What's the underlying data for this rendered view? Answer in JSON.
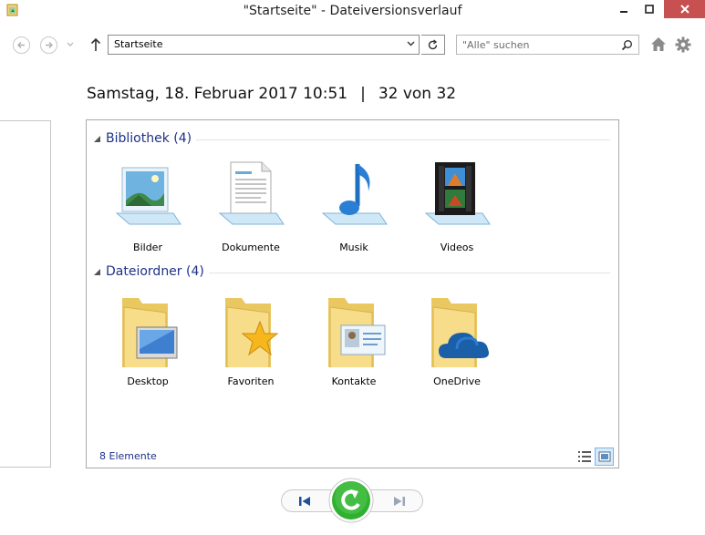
{
  "window": {
    "title": "\"Startseite\" - Dateiversionsverlauf"
  },
  "nav": {
    "address": "Startseite",
    "search_placeholder": "\"Alle\" suchen"
  },
  "header": {
    "datetime": "Samstag, 18. Februar 2017 10:51",
    "separator": "|",
    "position": "32 von 32"
  },
  "groups": [
    {
      "label": "Bibliothek (4)",
      "items": [
        {
          "label": "Bilder",
          "icon": "pictures-library-icon"
        },
        {
          "label": "Dokumente",
          "icon": "documents-library-icon"
        },
        {
          "label": "Musik",
          "icon": "music-library-icon"
        },
        {
          "label": "Videos",
          "icon": "videos-library-icon"
        }
      ]
    },
    {
      "label": "Dateiordner (4)",
      "items": [
        {
          "label": "Desktop",
          "icon": "desktop-folder-icon"
        },
        {
          "label": "Favoriten",
          "icon": "favorites-folder-icon"
        },
        {
          "label": "Kontakte",
          "icon": "contacts-folder-icon"
        },
        {
          "label": "OneDrive",
          "icon": "onedrive-folder-icon"
        }
      ]
    }
  ],
  "status": {
    "count": "8 Elemente"
  },
  "colors": {
    "group_header": "#1e3287",
    "restore_green": "#2fb02f",
    "close_red": "#c75050"
  }
}
